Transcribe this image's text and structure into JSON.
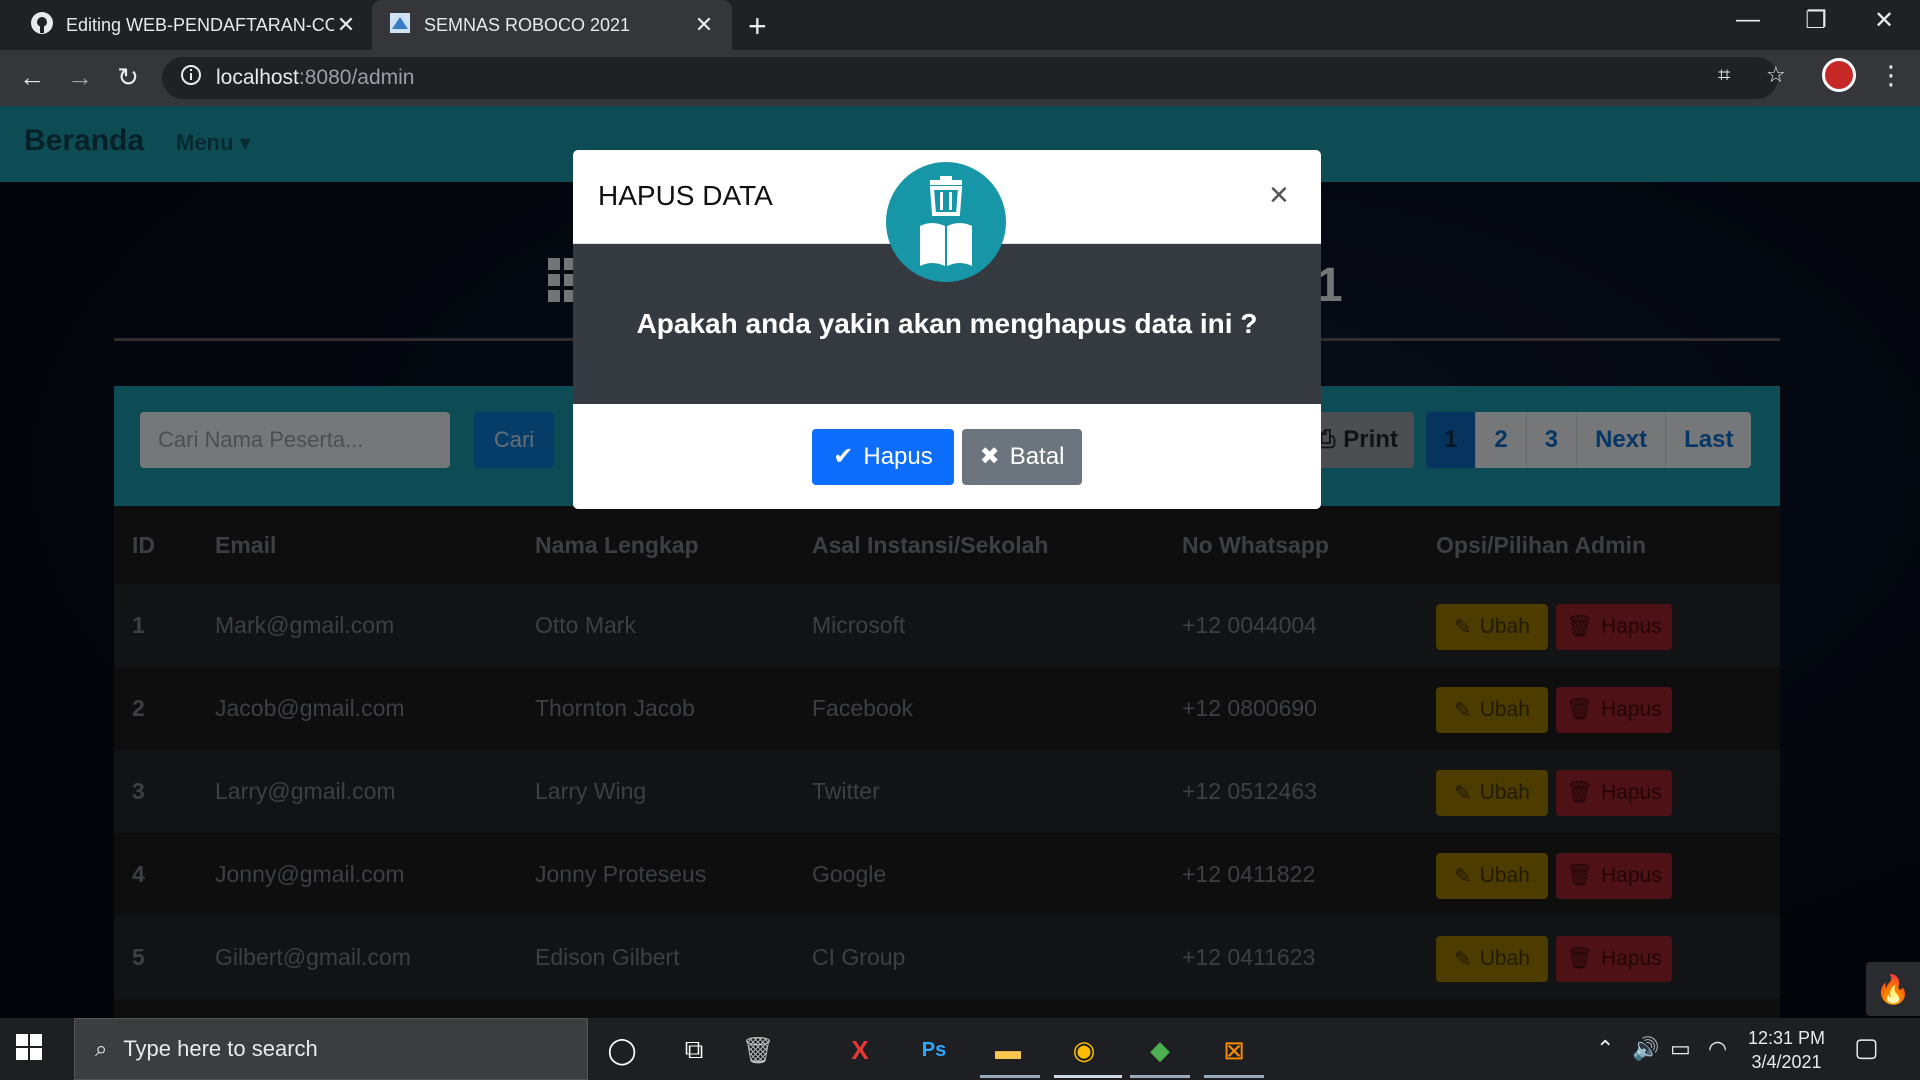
{
  "browser": {
    "tabs": [
      {
        "title": "Editing WEB-PENDAFTARAN-CO",
        "active": false
      },
      {
        "title": "SEMNAS ROBOCO 2021",
        "active": true
      }
    ],
    "url_host": "localhost",
    "url_path": ":8080/admin"
  },
  "navbar": {
    "brand": "Beranda",
    "menu_label": "Menu"
  },
  "page": {
    "heading_partial": "1",
    "search_placeholder": "Cari Nama Peserta...",
    "search_button": "Cari",
    "print_button": "Print",
    "pagination": [
      "1",
      "2",
      "3",
      "Next",
      "Last"
    ],
    "active_page": "1"
  },
  "table": {
    "headers": [
      "ID",
      "Email",
      "Nama Lengkap",
      "Asal Instansi/Sekolah",
      "No Whatsapp",
      "Opsi/Pilihan Admin"
    ],
    "rows": [
      {
        "id": "1",
        "email": "Mark@gmail.com",
        "nama": "Otto Mark",
        "instansi": "Microsoft",
        "wa": "+12 0044004"
      },
      {
        "id": "2",
        "email": "Jacob@gmail.com",
        "nama": "Thornton Jacob",
        "instansi": "Facebook",
        "wa": "+12 0800690"
      },
      {
        "id": "3",
        "email": "Larry@gmail.com",
        "nama": "Larry Wing",
        "instansi": "Twitter",
        "wa": "+12 0512463"
      },
      {
        "id": "4",
        "email": "Jonny@gmail.com",
        "nama": "Jonny Proteseus",
        "instansi": "Google",
        "wa": "+12 0411822"
      },
      {
        "id": "5",
        "email": "Gilbert@gmail.com",
        "nama": "Edison Gilbert",
        "instansi": "CI Group",
        "wa": "+12 0411623"
      }
    ],
    "edit_label": "Ubah",
    "delete_label": "Hapus"
  },
  "modal": {
    "title": "HAPUS DATA",
    "close": "×",
    "message": "Apakah anda yakin akan menghapus data ini ?",
    "confirm_label": "Hapus",
    "cancel_label": "Batal"
  },
  "taskbar": {
    "search_placeholder": "Type here to search",
    "time": "12:31 PM",
    "date": "3/4/2021"
  },
  "colors": {
    "navbar": "#1a8a9b",
    "modal_body": "#343a40",
    "confirm": "#0d6efd",
    "cancel": "#6c757d",
    "edit": "#ffc107",
    "delete": "#dc3545"
  }
}
